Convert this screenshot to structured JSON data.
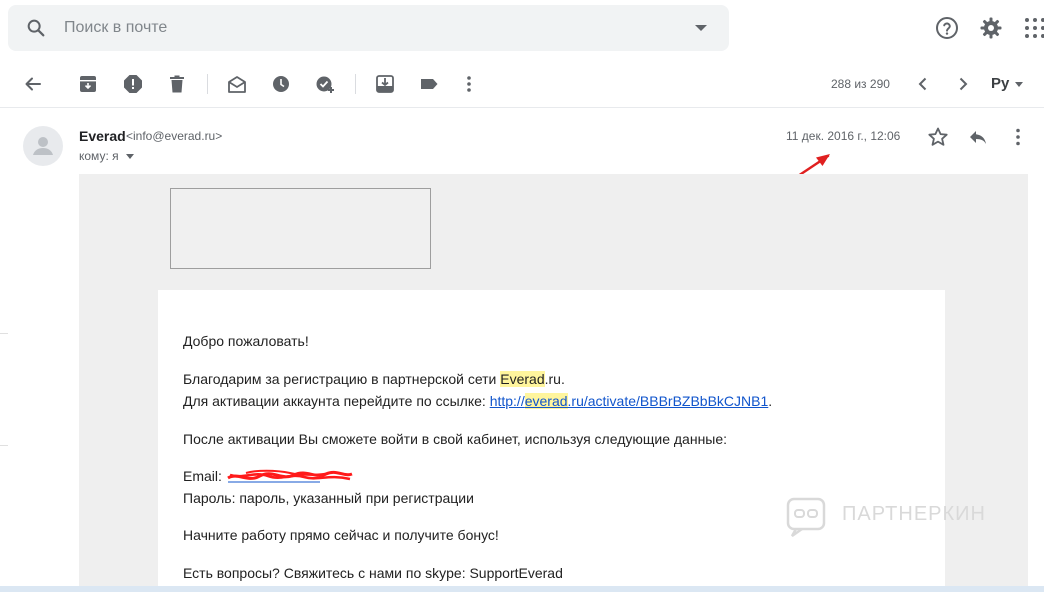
{
  "search": {
    "placeholder": "Поиск в почте"
  },
  "toolbar": {
    "counter": "288 из 290",
    "language": "Ру"
  },
  "message": {
    "sender_name": "Everad",
    "sender_email": "<info@everad.ru>",
    "to_label": "кому: я",
    "date": "11 дек. 2016 г., 12:06"
  },
  "body": {
    "greeting": "Добро пожаловать!",
    "thanks_before": "Благодарим за регистрацию в партнерской сети ",
    "thanks_brand": "Everad",
    "thanks_after": ".ru.",
    "activation_prefix": "Для активации аккаунта перейдите по ссылке: ",
    "activation_link_part1": "http://",
    "activation_link_brand": "everad",
    "activation_link_part2": ".ru/activate/BBBrBZBbBkCJNB1",
    "activation_suffix": ".",
    "after_activation": "После активации Вы сможете войти в свой кабинет, используя следующие данные:",
    "email_label": "Email: ",
    "password_line": "Пароль: пароль, указанный при регистрации",
    "start_work": "Начните работу прямо сейчас и получите бонус!",
    "questions": "Есть вопросы? Свяжитесь с нами по skype: SupportEverad"
  },
  "watermark": {
    "text": "ПАРТНЕРКИН"
  },
  "colors": {
    "link": "#1155cc",
    "highlight": "#fff59d",
    "annotation_arrow": "#e02020",
    "mail_background": "#efefef"
  },
  "icons": {
    "search": "search-icon",
    "help": "help-icon",
    "settings": "gear-icon",
    "apps": "apps-grid-icon",
    "back": "arrow-back-icon",
    "archive": "archive-icon",
    "spam": "report-spam-icon",
    "delete": "trash-icon",
    "mark_unread": "mark-unread-icon",
    "snooze": "clock-icon",
    "add_task": "add-task-icon",
    "move_to": "move-to-icon",
    "label": "label-icon",
    "more": "more-vert-icon",
    "prev": "chevron-left-icon",
    "next": "chevron-right-icon",
    "star": "star-icon",
    "reply": "reply-icon"
  }
}
